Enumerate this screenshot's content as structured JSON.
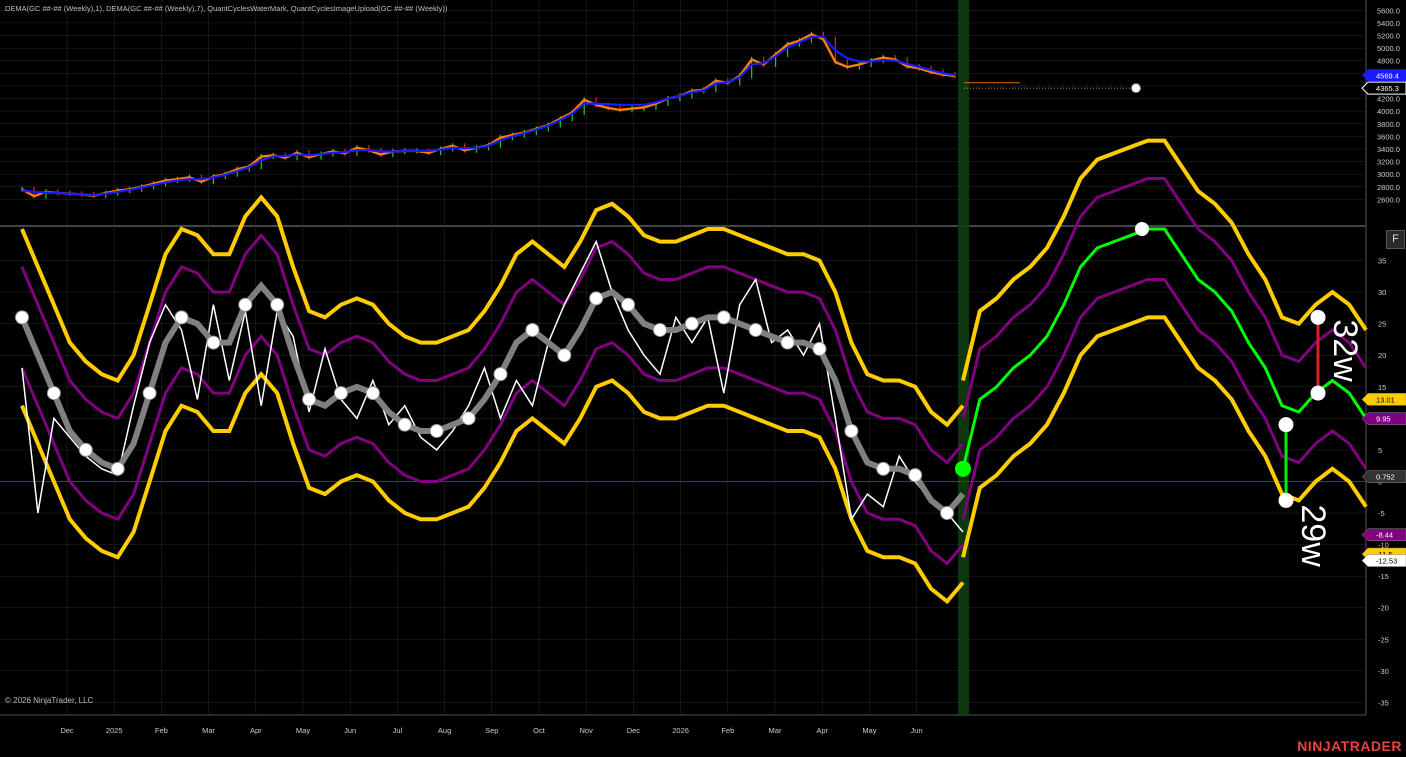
{
  "header": {
    "indicators_text": "DEMA(GC ##-## (Weekly),1), DEMA(GC ##-## (Weekly),7), QuantCyclesWaterMark, QuantCyclesImageUpload(GC ##-## (Weekly))"
  },
  "footer": {
    "copyright": "© 2026 NinjaTrader, LLC",
    "brand": "NINJATRADER"
  },
  "panel_button": "F",
  "colors": {
    "background": "#000000",
    "grid": "#2a2a2a",
    "price_fast": "#ff7f00",
    "price_slow": "#1a1aff",
    "band_outer": "#ffcc00",
    "band_inner": "#800080",
    "cycle_line": "#808080",
    "projection": "#00ff00",
    "price_line": "#ffffff",
    "zero_line": "#cc0000",
    "forecast_highlight": "#0d3d0d",
    "brand": "#e8433a"
  },
  "chart_data": [
    {
      "type": "line",
      "panel": "price",
      "title": "",
      "y_ticks": [
        5600,
        5400,
        5200,
        5000,
        4800,
        4600,
        4400,
        4200,
        4000,
        3800,
        3600,
        3400,
        3200,
        3000,
        2800,
        2600
      ],
      "ylim": [
        2400,
        5700
      ],
      "x_ticks": [
        "Dec",
        "2025",
        "Feb",
        "Mar",
        "Apr",
        "May",
        "Jun",
        "Jul",
        "Aug",
        "Sep",
        "Oct",
        "Nov",
        "Dec",
        "2026",
        "Feb",
        "Mar",
        "Apr",
        "May",
        "Jun"
      ],
      "series": [
        {
          "name": "DEMA(GC ##-## (Weekly),1)",
          "values": [
            2760,
            2650,
            2720,
            2700,
            2690,
            2680,
            2660,
            2700,
            2740,
            2760,
            2800,
            2850,
            2900,
            2920,
            2950,
            2880,
            2960,
            3000,
            3080,
            3120,
            3280,
            3300,
            3260,
            3340,
            3270,
            3320,
            3360,
            3330,
            3420,
            3380,
            3310,
            3360,
            3370,
            3370,
            3340,
            3400,
            3450,
            3380,
            3420,
            3460,
            3580,
            3620,
            3660,
            3720,
            3780,
            3880,
            3980,
            4180,
            4100,
            4050,
            4020,
            4040,
            4060,
            4120,
            4200,
            4240,
            4320,
            4340,
            4480,
            4450,
            4560,
            4820,
            4740,
            4900,
            5060,
            5120,
            5220,
            5140,
            4780,
            4700,
            4740,
            4800,
            4850,
            4820,
            4710,
            4680,
            4620,
            4580,
            4560
          ]
        },
        {
          "name": "DEMA(GC ##-## (Weekly),7)",
          "values": [
            2740,
            2720,
            2710,
            2700,
            2690,
            2680,
            2670,
            2690,
            2720,
            2750,
            2790,
            2830,
            2870,
            2900,
            2920,
            2920,
            2950,
            2990,
            3050,
            3110,
            3220,
            3280,
            3290,
            3310,
            3300,
            3320,
            3340,
            3350,
            3380,
            3380,
            3360,
            3360,
            3370,
            3370,
            3370,
            3390,
            3420,
            3410,
            3420,
            3450,
            3540,
            3600,
            3650,
            3710,
            3770,
            3860,
            3960,
            4120,
            4120,
            4110,
            4100,
            4100,
            4100,
            4140,
            4200,
            4240,
            4300,
            4330,
            4440,
            4460,
            4540,
            4740,
            4760,
            4870,
            5010,
            5090,
            5180,
            5180,
            4960,
            4840,
            4790,
            4790,
            4810,
            4800,
            4750,
            4700,
            4650,
            4600,
            4570
          ]
        }
      ],
      "price_labels": [
        {
          "value": "4569.4",
          "color": "#1a1aff"
        },
        {
          "value": "4365.3",
          "color": "#ffffff"
        }
      ]
    },
    {
      "type": "line",
      "panel": "cycles",
      "title": "",
      "y_ticks": [
        35,
        30,
        25,
        20,
        15,
        10,
        5,
        0,
        -5,
        -10,
        -15,
        -20,
        -25,
        -30,
        -35
      ],
      "ylim": [
        -37,
        40
      ],
      "series": [
        {
          "name": "cycle",
          "values": [
            26,
            20,
            14,
            8,
            5,
            3,
            2,
            6,
            14,
            22,
            26,
            25,
            22,
            22,
            28,
            31,
            28,
            20,
            13,
            12,
            14,
            15,
            14,
            11,
            9,
            8,
            8,
            9,
            10,
            13,
            17,
            22,
            24,
            22,
            20,
            24,
            29,
            30,
            28,
            25,
            24,
            24,
            25,
            26,
            26,
            25,
            24,
            23,
            22,
            22,
            21,
            16,
            8,
            3,
            2,
            2,
            1,
            -3,
            -5,
            -2
          ]
        },
        {
          "name": "price",
          "values": [
            18,
            -5,
            10,
            7,
            4,
            2,
            1,
            12,
            22,
            28,
            24,
            13,
            28,
            16,
            27,
            12,
            27,
            23,
            11,
            21,
            13,
            10,
            16,
            9,
            12,
            7,
            5,
            8,
            12,
            18,
            10,
            16,
            12,
            22,
            28,
            33,
            38,
            30,
            24,
            20,
            17,
            26,
            22,
            26,
            14,
            28,
            32,
            22,
            24,
            20,
            25,
            10,
            -6,
            -2,
            -4,
            4,
            0,
            -3,
            -5,
            -8
          ]
        },
        {
          "name": "projection",
          "values": [
            2,
            13,
            15,
            18,
            20,
            23,
            28,
            34,
            37,
            38,
            39,
            40,
            40,
            36,
            32,
            30,
            27,
            22,
            18,
            12,
            11,
            14,
            16,
            14,
            10
          ]
        }
      ],
      "bands": {
        "outer_upper_name": "upper",
        "outer_lower_name": "lower",
        "center_offset_outer": 14,
        "center_offset_inner": 8
      },
      "cycle_markers": [
        {
          "label": "32w",
          "top": 26,
          "bottom": 14,
          "color": "#e02020"
        },
        {
          "label": "29w",
          "top": 9,
          "bottom": -3,
          "color": "#00ee00"
        }
      ],
      "value_labels": [
        {
          "value": "13.01",
          "color": "#ffcc00"
        },
        {
          "value": "9.95",
          "color": "#800080"
        },
        {
          "value": "0.752",
          "color": "#333333"
        },
        {
          "value": "-8.44",
          "color": "#800080"
        },
        {
          "value": "-11.5",
          "color": "#ffcc00"
        },
        {
          "value": "-12.53",
          "color": "#ffffff"
        }
      ],
      "zero_line": 0
    }
  ]
}
